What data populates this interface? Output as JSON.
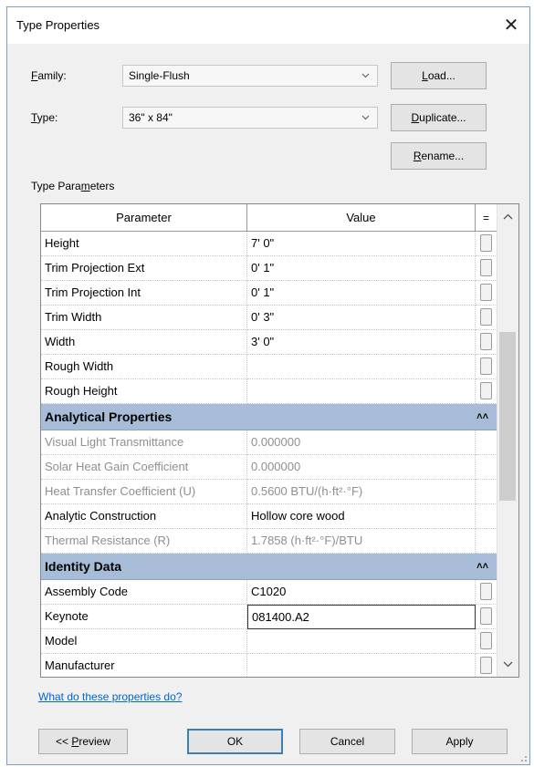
{
  "window": {
    "title": "Type Properties",
    "close_glyph": "✕"
  },
  "family": {
    "label_key": "F",
    "label_rest": "amily:",
    "value": "Single-Flush"
  },
  "type": {
    "label_key": "T",
    "label_rest": "ype:",
    "value": "36\" x 84\""
  },
  "buttons": {
    "load_key": "L",
    "load_rest": "oad...",
    "duplicate_key": "D",
    "duplicate_rest": "uplicate...",
    "rename_key": "R",
    "rename_rest": "ename...",
    "preview_pre": "<< ",
    "preview_key": "P",
    "preview_rest": "review",
    "ok": "OK",
    "cancel": "Cancel",
    "apply": "Apply"
  },
  "type_parameters": {
    "label_pre": "Type Para",
    "label_key": "m",
    "label_post": "eters"
  },
  "grid": {
    "col_parameter": "Parameter",
    "col_value": "Value",
    "col_toggle": "=",
    "dimension_rows": [
      {
        "param": "Height",
        "value": "7'  0\""
      },
      {
        "param": "Trim Projection Ext",
        "value": "0'  1\""
      },
      {
        "param": "Trim Projection Int",
        "value": "0'  1\""
      },
      {
        "param": "Trim Width",
        "value": "0'  3\""
      },
      {
        "param": "Width",
        "value": "3'  0\""
      },
      {
        "param": "Rough Width",
        "value": ""
      },
      {
        "param": "Rough Height",
        "value": ""
      }
    ],
    "group_analytical": "Analytical Properties",
    "analytical_rows": [
      {
        "param": "Visual Light Transmittance",
        "value": "0.000000"
      },
      {
        "param": "Solar Heat Gain Coefficient",
        "value": "0.000000"
      },
      {
        "param": "Heat Transfer Coefficient (U)",
        "value": "0.5600 BTU/(h·ft²·°F)"
      },
      {
        "param": "Analytic Construction",
        "value": "Hollow core wood"
      },
      {
        "param": "Thermal Resistance (R)",
        "value": "1.7858 (h·ft²·°F)/BTU"
      }
    ],
    "group_identity": "Identity Data",
    "identity_rows": [
      {
        "param": "Assembly Code",
        "value": "C1020"
      },
      {
        "param": "Keynote",
        "value": "081400.A2"
      },
      {
        "param": "Model",
        "value": ""
      },
      {
        "param": "Manufacturer",
        "value": ""
      }
    ]
  },
  "help_link": "What do these properties do?"
}
